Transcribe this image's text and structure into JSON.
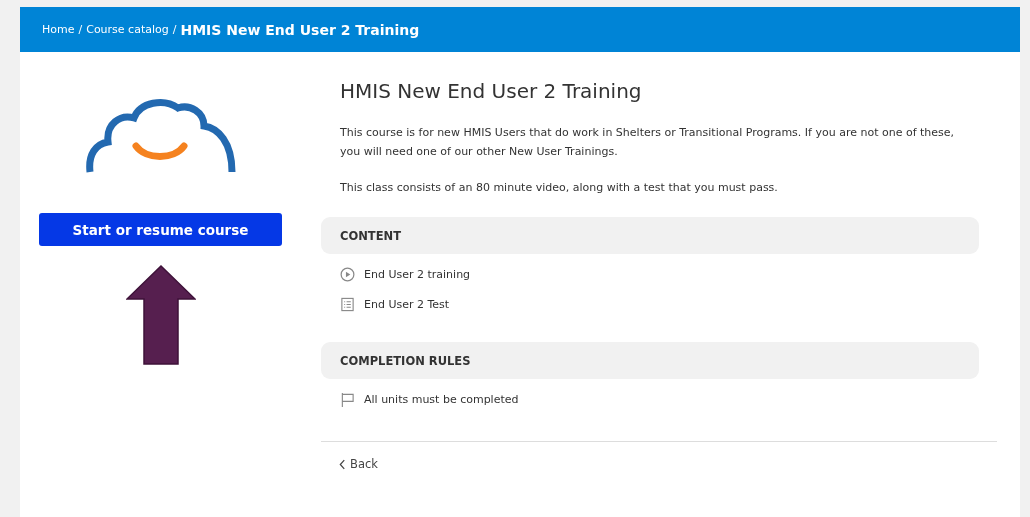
{
  "breadcrumb": [
    {
      "label": "Home",
      "current": false
    },
    {
      "separator": "/",
      "label": "Course catalog",
      "current": false
    },
    {
      "separator": "/",
      "label": "HMIS New End User 2 Training",
      "current": true
    }
  ],
  "start_button": "Start or resume course",
  "course": {
    "title": "HMIS New End User 2 Training",
    "paragraphs": [
      "This course is for new HMIS Users that do work in Shelters or Transitional Programs. If you are not one of these, you will need one of our other New User Trainings.",
      "This class consists of an 80 minute video, along with a test that you must pass."
    ]
  },
  "sections": [
    {
      "heading": "CONTENT",
      "items": [
        {
          "kind": "video",
          "label": "End User 2 training"
        },
        {
          "kind": "test",
          "label": "End User 2 Test"
        }
      ]
    },
    {
      "heading": "COMPLETION RULES",
      "items": [
        {
          "kind": "rule",
          "label": "All units must be completed"
        }
      ]
    }
  ],
  "back_link": "Back"
}
